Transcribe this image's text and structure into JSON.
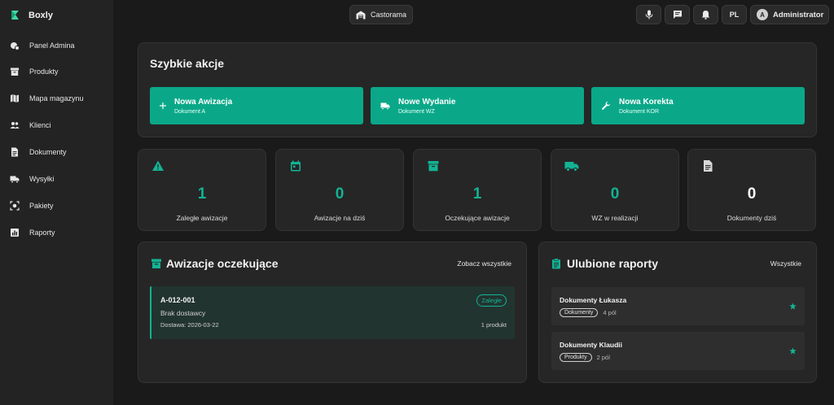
{
  "app": {
    "name": "Boxly"
  },
  "sidebar": {
    "items": [
      {
        "label": "Panel Admina",
        "icon": "admin-panel-icon"
      },
      {
        "label": "Produkty",
        "icon": "archive-box-icon"
      },
      {
        "label": "Mapa magazynu",
        "icon": "map-icon"
      },
      {
        "label": "Klienci",
        "icon": "people-icon"
      },
      {
        "label": "Dokumenty",
        "icon": "document-icon"
      },
      {
        "label": "Wysyłki",
        "icon": "truck-icon"
      },
      {
        "label": "Pakiety",
        "icon": "package-scan-icon"
      },
      {
        "label": "Raporty",
        "icon": "bar-chart-icon"
      }
    ]
  },
  "header": {
    "store": "Castorama",
    "lang": "PL",
    "user_initial": "A",
    "user": "Administrator"
  },
  "quick_actions": {
    "title": "Szybkie akcje",
    "items": [
      {
        "title": "Nowa Awizacja",
        "sub": "Dokument A",
        "icon": "plus-icon"
      },
      {
        "title": "Nowe Wydanie",
        "sub": "Dokument WZ",
        "icon": "truck-icon"
      },
      {
        "title": "Nowa Korekta",
        "sub": "Dokument KOR",
        "icon": "wrench-icon"
      }
    ]
  },
  "stats": [
    {
      "value": "1",
      "label": "Zaległe awizacje",
      "icon": "warning-icon"
    },
    {
      "value": "0",
      "label": "Awizacje na dziś",
      "icon": "calendar-icon"
    },
    {
      "value": "1",
      "label": "Oczekujące awizacje",
      "icon": "archive-box-icon"
    },
    {
      "value": "0",
      "label": "WZ w realizacji",
      "icon": "truck-icon"
    },
    {
      "value": "0",
      "label": "Dokumenty dziś",
      "icon": "document-icon"
    }
  ],
  "pending": {
    "title": "Awizacje oczekujące",
    "link": "Zobacz wszystkie",
    "items": [
      {
        "id": "A-012-001",
        "status": "Zaległe",
        "note": "Brak dostawcy",
        "delivery": "Dostawa: 2026-03-22",
        "products": "1 produkt"
      }
    ]
  },
  "favorites": {
    "title": "Ulubione raporty",
    "link": "Wszystkie",
    "items": [
      {
        "name": "Dokumenty Łukasza",
        "tag": "Dokumenty",
        "fields": "4 pól"
      },
      {
        "name": "Dokumenty Klaudii",
        "tag": "Produkty",
        "fields": "2 pól"
      }
    ]
  },
  "colors": {
    "accent": "#0aa889",
    "accent_text": "#13b394",
    "bg": "#1a1a1a",
    "card": "#262626",
    "sidebar": "#232323"
  }
}
